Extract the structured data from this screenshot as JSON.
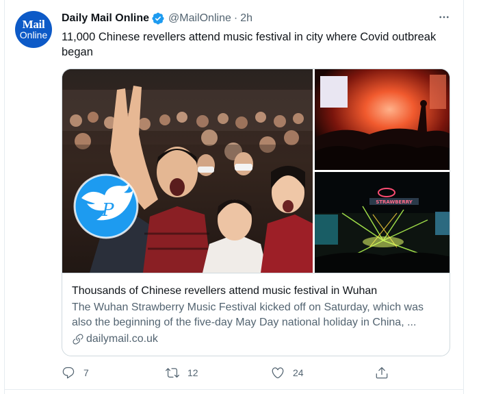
{
  "author": {
    "avatar_line1": "Mail",
    "avatar_line2": "Online",
    "name": "Daily Mail Online",
    "handle": "@MailOnline",
    "separator": "·",
    "time": "2h"
  },
  "tweet": {
    "text": "11,000 Chinese revellers attend music festival in city where Covid outbreak began"
  },
  "card": {
    "title": "Thousands of Chinese revellers attend music festival in Wuhan",
    "description": "The Wuhan Strawberry Music Festival kicked off on Saturday, which was also the beginning of the five-day May Day national holiday in China, ...",
    "domain": "dailymail.co.uk",
    "stage_sign": "STRAWBERRY"
  },
  "actions": {
    "replies": "7",
    "retweets": "12",
    "likes": "24"
  },
  "colors": {
    "verified": "#1d9bf0",
    "avatar_bg": "#0d5ac7",
    "secondary_text": "#536471",
    "border": "#cfd9de",
    "watermark": "#1d9bf0"
  },
  "icons": [
    "verified-badge-icon",
    "more-icon",
    "link-icon",
    "reply-icon",
    "retweet-icon",
    "like-icon",
    "share-icon",
    "watermark-bird-icon"
  ]
}
